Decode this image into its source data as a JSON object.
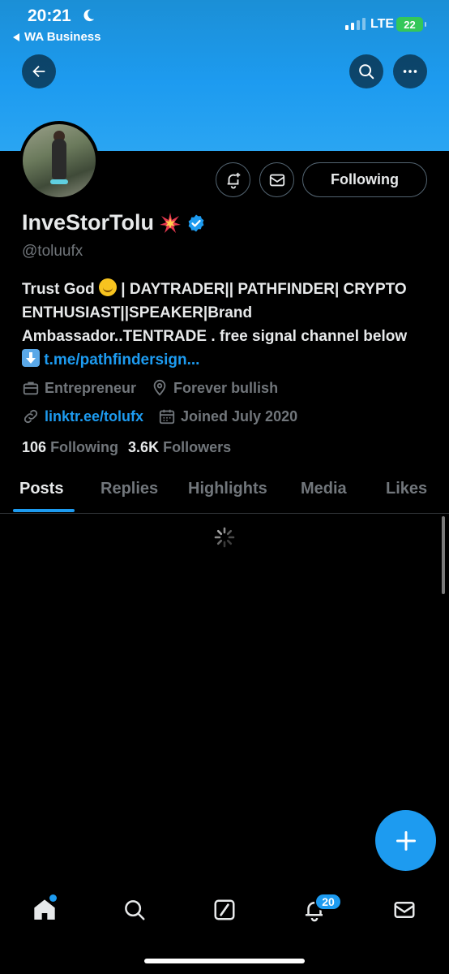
{
  "status_bar": {
    "time": "20:21",
    "back_app": "WA Business",
    "network": "LTE",
    "battery": "22"
  },
  "profile": {
    "name": "InveStorTolu",
    "handle": "@toluufx",
    "follow_button": "Following",
    "bio_text_1": "Trust God",
    "bio_text_2": "| DAYTRADER|| PATHFINDER| CRYPTO ENTHUSIAST||SPEAKER|Brand Ambassador..TENTRADE . free signal channel below",
    "bio_link": "t.me/pathfindersign...",
    "profession": "Entrepreneur",
    "location": "Forever bullish",
    "website": "linktr.ee/tolufx",
    "joined": "Joined July 2020",
    "following_count": "106",
    "following_label": "Following",
    "followers_count": "3.6K",
    "followers_label": "Followers"
  },
  "tabs": [
    {
      "label": "Posts",
      "active": true
    },
    {
      "label": "Replies",
      "active": false
    },
    {
      "label": "Highlights",
      "active": false
    },
    {
      "label": "Media",
      "active": false
    },
    {
      "label": "Likes",
      "active": false
    }
  ],
  "bottom_nav": {
    "notifications_badge": "20",
    "items": [
      "home-icon",
      "search-icon",
      "grok-icon",
      "bell-icon",
      "mail-icon"
    ]
  },
  "colors": {
    "accent": "#1d9bf0",
    "background": "#000000",
    "muted_text": "#71767b"
  }
}
